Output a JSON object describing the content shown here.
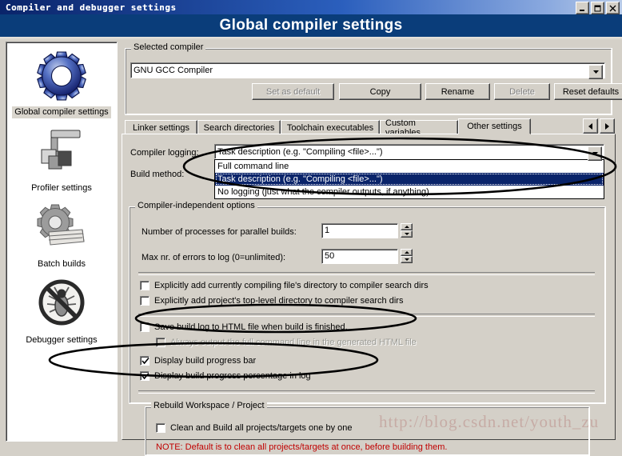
{
  "window": {
    "title": "Compiler and debugger settings",
    "banner_title": "Global compiler settings",
    "controls": {
      "minimize": "minimize-button",
      "maximize": "maximize-button",
      "close": "close-button"
    }
  },
  "sidebar": {
    "items": [
      {
        "label": "Global compiler settings",
        "icon": "gear-icon",
        "selected": true
      },
      {
        "label": "Profiler settings",
        "icon": "caliper-blocks-icon",
        "selected": false
      },
      {
        "label": "Batch builds",
        "icon": "gear-stack-icon",
        "selected": false
      },
      {
        "label": "Debugger settings",
        "icon": "no-bug-icon",
        "selected": false
      }
    ]
  },
  "selected_compiler": {
    "group_label": "Selected compiler",
    "value": "GNU GCC Compiler",
    "buttons": [
      {
        "label": "Set as default",
        "enabled": false
      },
      {
        "label": "Copy",
        "enabled": true
      },
      {
        "label": "Rename",
        "enabled": true
      },
      {
        "label": "Delete",
        "enabled": false
      },
      {
        "label": "Reset defaults",
        "enabled": true
      }
    ]
  },
  "tabs": {
    "items": [
      {
        "label": "Linker settings",
        "active": false
      },
      {
        "label": "Search directories",
        "active": false
      },
      {
        "label": "Toolchain executables",
        "active": false
      },
      {
        "label": "Custom variables",
        "active": false
      },
      {
        "label": "Other settings",
        "active": true
      }
    ],
    "scroll_left": "◄",
    "scroll_right": "►"
  },
  "other_settings": {
    "compiler_logging_label": "Compiler logging:",
    "compiler_logging_value": "Task description (e.g. \"Compiling <file>...\")",
    "compiler_logging_options": [
      {
        "label": "Full command line",
        "selected": false
      },
      {
        "label": "Task description (e.g. \"Compiling <file>...\")",
        "selected": true
      },
      {
        "label": "No logging (just what the compiler outputs, if anything)",
        "selected": false
      }
    ],
    "build_method_label": "Build method:",
    "independent_group_label": "Compiler-independent options",
    "processes_label": "Number of processes for parallel builds:",
    "processes_value": "1",
    "max_errors_label": "Max nr. of errors to log (0=unlimited):",
    "max_errors_value": "50",
    "checkboxes": [
      {
        "label": "Explicitly add currently compiling file's directory to compiler search dirs",
        "checked": false,
        "enabled": true
      },
      {
        "label": "Explicitly add project's top-level directory to compiler search dirs",
        "checked": false,
        "enabled": true
      },
      {
        "label": "Save build log to HTML file when build is finished.",
        "checked": false,
        "enabled": true
      },
      {
        "label": "Always output the full command line in the generated HTML file",
        "checked": false,
        "enabled": false
      },
      {
        "label": "Display build progress bar",
        "checked": true,
        "enabled": true
      },
      {
        "label": "Display build progress percentage in log",
        "checked": true,
        "enabled": true
      }
    ],
    "rebuild_group_label": "Rebuild Workspace / Project",
    "rebuild_checkbox": {
      "label": "Clean and Build all projects/targets one by one",
      "checked": false
    },
    "rebuild_note": "NOTE: Default is to clean all projects/targets at once, before building them."
  },
  "watermark": {
    "text": "http://blog.csdn.net/youth_zu"
  },
  "colors": {
    "face": "#d4d0c8",
    "banner": "#0a3d7a",
    "title_gradient_start": "#0a246a",
    "highlight": "#0a246a",
    "note_red": "#c00000",
    "disabled_text": "#808080"
  }
}
